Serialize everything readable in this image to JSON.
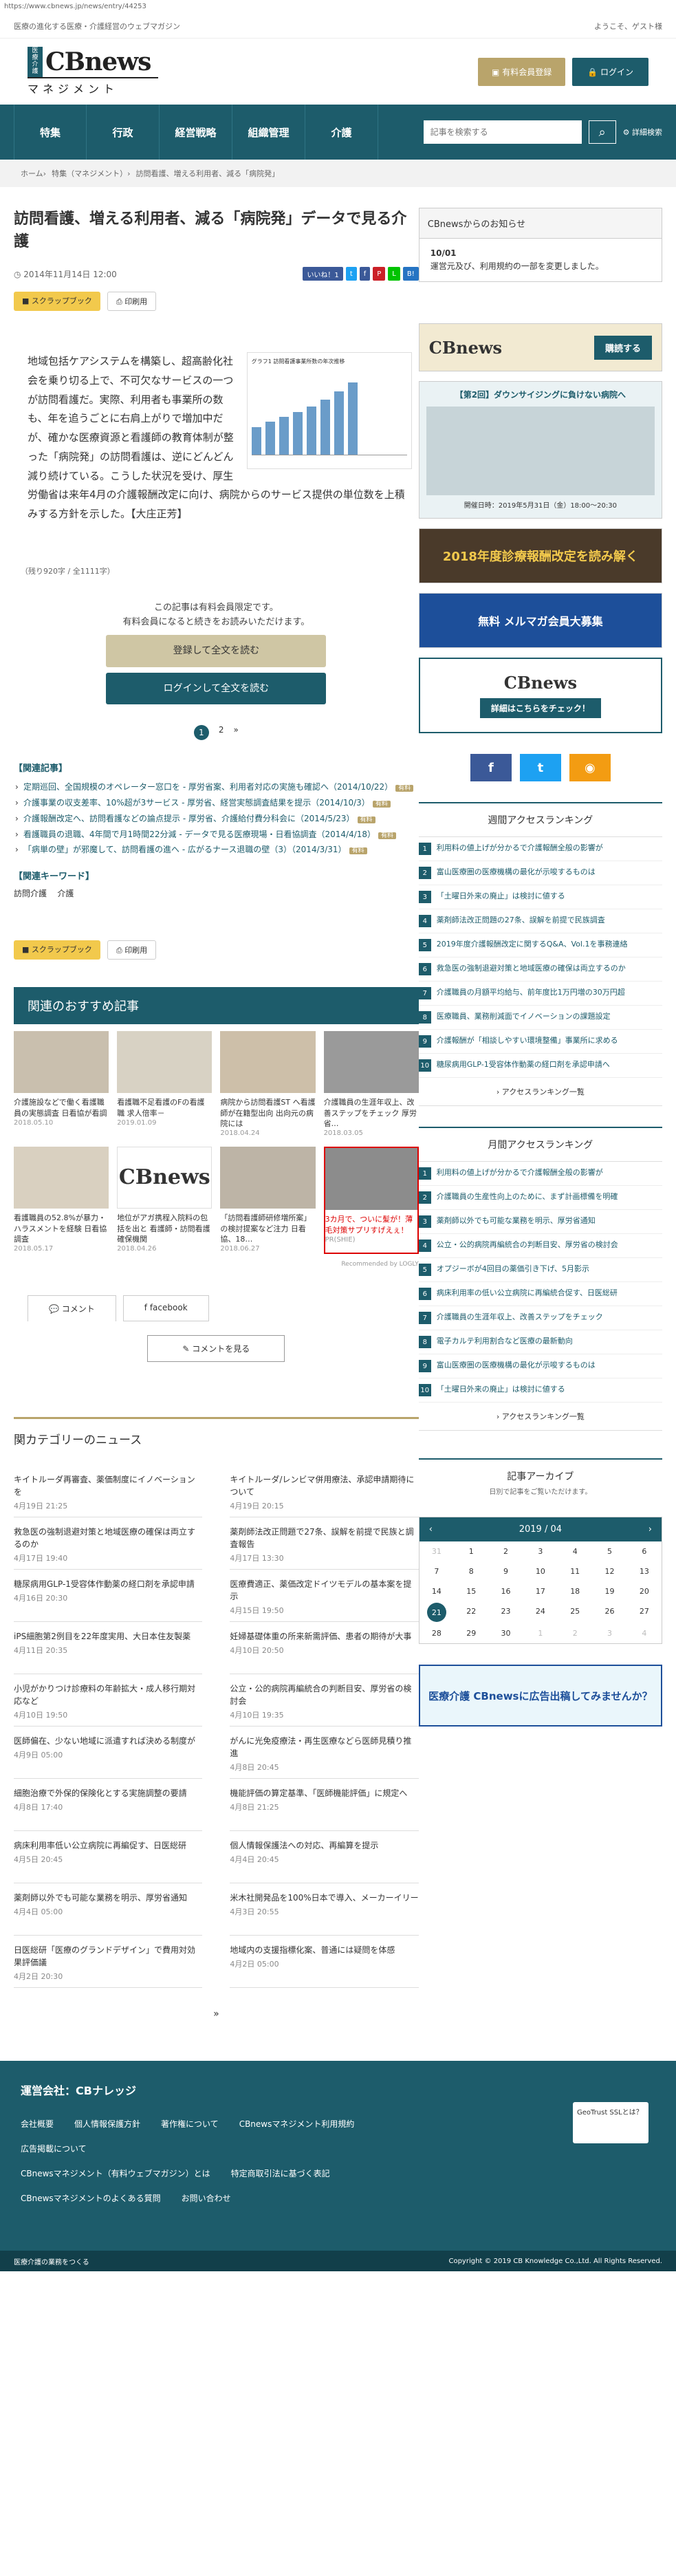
{
  "url": "https://www.cbnews.jp/news/entry/44253",
  "topstrip": {
    "tagline": "医療の進化する医療・介護経営のウェブマガジン",
    "greeting": "ようこそ、ゲスト様"
  },
  "logo": {
    "badge": "医療介護",
    "name": "CBnews",
    "sub": "マネジメント"
  },
  "header": {
    "register": "有料会員登録",
    "login": "ログイン"
  },
  "nav": [
    "特集",
    "行政",
    "経営戦略",
    "組織管理",
    "介護"
  ],
  "search": {
    "placeholder": "記事を検索する",
    "detail": "詳細検索"
  },
  "breadcrumb": [
    "ホーム",
    "特集（マネジメント）",
    "訪問看護、増える利用者、減る「病院発」"
  ],
  "article": {
    "title": "訪問看護、増える利用者、減る「病院発」データで見る介護",
    "date": "2014年11月14日 12:00",
    "scrapbook": "スクラップブック",
    "print": "印刷用",
    "body": "地域包括ケアシステムを構築し、超高齢化社会を乗り切る上で、不可欠なサービスの一つが訪問看護だ。実際、利用者も事業所の数も、年を追うごとに右肩上がりで増加中だが、確かな医療資源と看護師の教育体制が整った「病院発」の訪問看護は、逆にどんどん減り続けている。こうした状況を受け、厚生労働省は来年4月の介護報酬改定に向け、病院からのサービス提供の単位数を上積みする方針を示した。【大庄正芳】",
    "thumb_title": "グラフ1 訪問看護事業所数の年次推移",
    "charcount": "（残り920字 / 全1111字）",
    "member_line1": "この記事は有料会員限定です。",
    "member_line2": "有料会員になると続きをお読みいただけます。",
    "read_btn": "登録して全文を読む",
    "login_btn": "ログインして全文を読む"
  },
  "shares": [
    {
      "label": "いいね！1",
      "color": "#3b5998"
    },
    {
      "label": "t",
      "color": "#1da1f2"
    },
    {
      "label": "f",
      "color": "#3b5998"
    },
    {
      "label": "P",
      "color": "#cb2027"
    },
    {
      "label": "L",
      "color": "#00c300"
    },
    {
      "label": "B!",
      "color": "#2574c3"
    }
  ],
  "pager": [
    "1",
    "2",
    "»"
  ],
  "related": {
    "heading": "【関連記事】",
    "items": [
      "定期巡回、全国規模のオペレーター窓口を - 厚労省案、利用者対応の実施も確認へ（2014/10/22）",
      "介護事業の収支差率、10%超が3サービス - 厚労省、経営実態調査結果を提示（2014/10/3）",
      "介護報酬改定へ、訪問看護などの論点提示 - 厚労省、介護給付費分科会に（2014/5/23）",
      "看護職員の退職、4年間で月1時間22分減 - データで見る医療現場・日看協調査（2014/4/18）",
      "「病単の壁」が邪魔して、訪問看護の進へ - 広がるナース退職の壁（3）（2014/3/31）"
    ],
    "badge": "有料"
  },
  "keywords": {
    "heading": "【関連キーワード】",
    "items": [
      "訪問介護",
      "介護"
    ]
  },
  "reco": {
    "heading": "関連のおすすめ記事",
    "items": [
      {
        "title": "介護施設などで働く看護職員の実態調査 日看協が看調",
        "date": "2018.05.10",
        "color": "#c9bfae"
      },
      {
        "title": "看護職不足看護のFの看護職 求人倍率－",
        "date": "2019.01.09",
        "color": "#d8d2c4"
      },
      {
        "title": "病院から訪問看護ST へ看護師が在籍型出向 出向元の病院には",
        "date": "2018.04.24",
        "color": "#cdbfa9"
      },
      {
        "title": "介護職員の生涯年収上、改善ステップをチェック 厚労省…",
        "date": "2018.03.05",
        "color": "#9a9a9a"
      },
      {
        "title": "看護職員の52.8%が暴力・ハラスメントを経験 日看協調査",
        "date": "2018.05.17",
        "color": "#d9d0c0"
      },
      {
        "title": "地位がアガ携程入院料の包括を出と 看護師・訪問看護確保機関",
        "date": "2018.04.26",
        "color": "#ffffff"
      },
      {
        "title": "「訪問看護師研修増所案」の検討提案など注力 日看協、18…",
        "date": "2018.06.27",
        "color": "#bdb4a6"
      },
      {
        "title": "3カ月で、ついに髪が！薄毛対策サプリすげえぇ！",
        "date": "PR(SHIE)",
        "color": "#8c8c8c"
      }
    ],
    "recommended_by": "Recommended by LOGLY"
  },
  "tabs": {
    "comment": "コメント",
    "facebook": "facebook",
    "see": "コメントを見る"
  },
  "category": {
    "heading": "関カテゴリーのニュース",
    "items": [
      {
        "title": "キイトルーダ再審査、薬価制度にイノベーションを",
        "date": "4月19日 21:25"
      },
      {
        "title": "キイトルーダ/レンビマ併用療法、承認申請期待について",
        "date": "4月19日 20:15"
      },
      {
        "title": "救急医の強制退避対策と地域医療の確保は両立するのか",
        "date": "4月17日 19:40"
      },
      {
        "title": "薬剤師法改正問題で27条、誤解を前提で民族と調査報告",
        "date": "4月17日 13:30"
      },
      {
        "title": "糖尿病用GLP-1受容体作動薬の経口剤を承認申請",
        "date": "4月16日 20:30"
      },
      {
        "title": "医療費適正、薬価改定ドイツモデルの基本案を提示",
        "date": "4月15日 19:50"
      },
      {
        "title": "iPS細胞第2例目を22年度実用、大日本住友製薬",
        "date": "4月11日 20:35"
      },
      {
        "title": "妊婦基礎体重の所来新需評価、患者の期待が大事",
        "date": "4月10日 20:50"
      },
      {
        "title": "小児がかりつけ診療料の年齢拡大・成人移行期対応など",
        "date": "4月10日 19:50"
      },
      {
        "title": "公立・公的病院再編統合の判断目安、厚労省の検討会",
        "date": "4月10日 19:35"
      },
      {
        "title": "医師偏在、少ない地域に派遣すれば決める制度が",
        "date": "4月9日 05:00"
      },
      {
        "title": "がんに光免疫療法・再生医療などら医師見積り推進",
        "date": "4月8日 20:45"
      },
      {
        "title": "細胞治療で外保的保険化とする実施調整の要請",
        "date": "4月8日 17:40"
      },
      {
        "title": "機能評価の算定基準、「医師機能評価」に規定へ",
        "date": "4月8日 21:25"
      },
      {
        "title": "病床利用率低い公立病院に再編促す、日医総研",
        "date": "4月5日 20:45"
      },
      {
        "title": "個人情報保護法への対応、再編算を提示",
        "date": "4月4日 20:45"
      },
      {
        "title": "薬剤師以外でも可能な業務を明示、厚労省通知",
        "date": "4月4日 05:00"
      },
      {
        "title": "米木社開発品を100%日本で導入、メーカーイリー",
        "date": "4月3日 20:55"
      },
      {
        "title": "日医総研「医療のグランドデザイン」で費用対効果評価議",
        "date": "4月2日 20:30"
      },
      {
        "title": "地域内の支援指標化案、普通には疑問を体感",
        "date": "4月2日 05:00"
      }
    ]
  },
  "side": {
    "notice_heading": "CBnewsからのお知らせ",
    "notice_date": "10/01",
    "notice_text": "運営元及び、利用規約の一部を変更しました。",
    "banner1": "購読する",
    "banner2_title": "【第2回】ダウンサイジングに負けない病院へ",
    "banner2_date": "開催日時：2019年5月31日（金）18:00〜20:30",
    "banner3": "2018年度診療報酬改定を読み解く",
    "banner4": "無料 メルマガ会員大募集",
    "banner5": "詳細はこちらをチェック！",
    "weekly_heading": "週間アクセスランキング",
    "weekly": [
      "利用料の値上げが分かるで介護報酬全般の影響が",
      "富山医療圏の医療機構の最化が示唆するものは",
      "「土曜日外来の廃止」は検討に値する",
      "薬剤師法改正問題の27条、誤解を前提で民族調査",
      "2019年度介護報酬改定に関するQ&A、Vol.1を事務連絡",
      "救急医の強制退避対策と地域医療の確保は両立するのか",
      "介護職員の月額平均給与、前年度比1万円増の30万円超",
      "医療職員、業務削減面でイノベーションの課題設定",
      "介護報酬が「相談しやすい環境整備」事業所に求める",
      "糖尿病用GLP-1受容体作動薬の経口剤を承認申請へ"
    ],
    "more": "アクセスランキング一覧",
    "monthly_heading": "月間アクセスランキング",
    "monthly": [
      "利用料の値上げが分かるで介護報酬全般の影響が",
      "介護職員の生産性向上のために、まず計画標備を明確",
      "薬剤師以外でも可能な業務を明示、厚労省通知",
      "公立・公的病院再編統合の判断目安、厚労省の検討会",
      "オプジーボが4回目の薬価引き下げ、5月影示",
      "病床利用率の低い公立病院に再編統合促す、日医総研",
      "介護職員の生涯年収上、改善ステップをチェック",
      "電子カルテ利用割合など医療の最新動向",
      "富山医療圏の医療機構の最化が示唆するものは",
      "「土曜日外来の廃止」は検討に値する"
    ],
    "archive_heading": "記事アーカイブ",
    "archive_sub": "日別で記事をご覧いただけます。",
    "cal_month": "2019 / 04",
    "cal_days": [
      "31",
      "1",
      "2",
      "3",
      "4",
      "5",
      "6",
      "7",
      "8",
      "9",
      "10",
      "11",
      "12",
      "13",
      "14",
      "15",
      "16",
      "17",
      "18",
      "19",
      "20",
      "21",
      "22",
      "23",
      "24",
      "25",
      "26",
      "27",
      "28",
      "29",
      "30",
      "1",
      "2",
      "3",
      "4"
    ],
    "banner6": "医療介護 CBnewsに広告出稿してみませんか？"
  },
  "footer": {
    "heading": "運営会社：CBナレッジ",
    "links1": [
      "会社概要",
      "個人情報保護方針",
      "著作権について",
      "CBnewsマネジメント利用規約"
    ],
    "links2": [
      "広告掲載について"
    ],
    "links3": [
      "CBnewsマネジメント（有料ウェブマガジン）とは",
      "特定商取引法に基づく表記"
    ],
    "links4": [
      "CBnewsマネジメントのよくある質問",
      "お問い合わせ"
    ],
    "geo": "GeoTrust SSLとは？",
    "bottom_left": "医療介護の業務をつくる",
    "copyright": "Copyright © 2019 CB Knowledge Co.,Ltd. All Rights Reserved."
  }
}
